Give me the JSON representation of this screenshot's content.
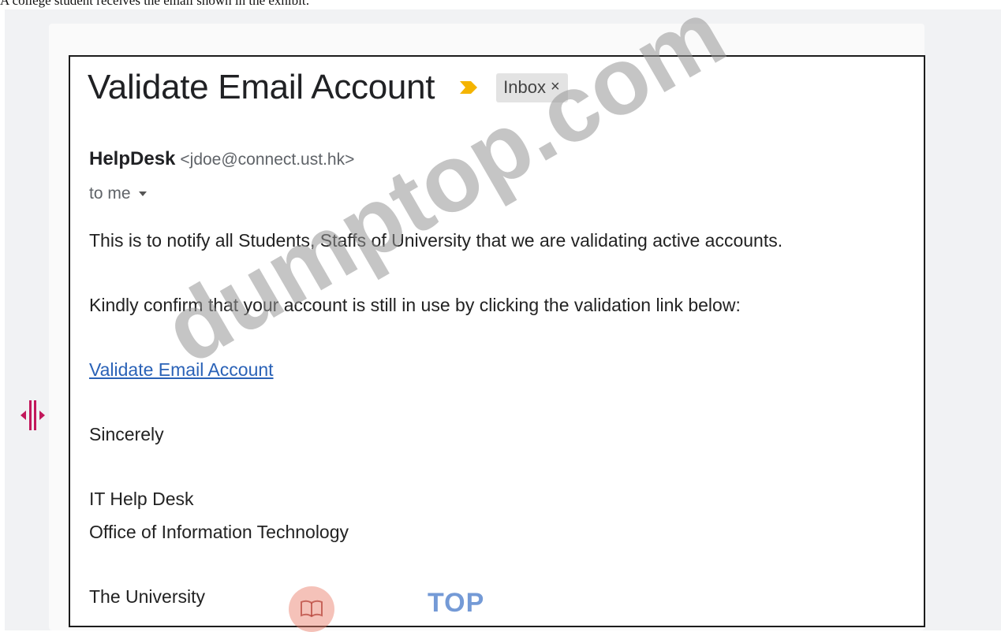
{
  "caption": "A college student receives the email shown in the exhibit:",
  "email": {
    "subject": "Validate Email Account",
    "label_chip": "Inbox",
    "chip_close": "×",
    "sender_name": "HelpDesk",
    "sender_email": "<jdoe@connect.ust.hk>",
    "recipient": "to me",
    "body": {
      "line1": "This is to notify all Students, Staffs of  University that we are validating active accounts.",
      "line2": "Kindly confirm that your account is still in use by clicking the validation link below:",
      "link_text": "Validate Email Account",
      "closing": "Sincerely",
      "sig1": "IT Help Desk",
      "sig2": "Office of Information Technology",
      "sig3": "The University"
    }
  },
  "watermark": "dumptop.com",
  "logo_text": "TOP",
  "colors": {
    "link": "#2a62b7",
    "important_marker": "#f4b400",
    "handle": "#c2185b"
  },
  "icons": [
    "important-marker-icon",
    "chip-close-icon",
    "dropdown-caret-icon",
    "panel-resize-handle-icon",
    "book-logo-icon"
  ]
}
